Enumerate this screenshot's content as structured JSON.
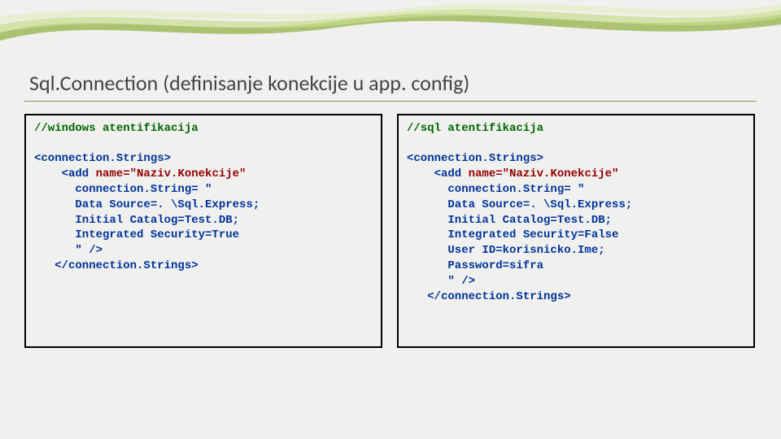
{
  "title": "Sql.Connection (definisanje konekcije u app. config)",
  "left": {
    "comment": "//windows atentifikacija",
    "l1": "<connection.Strings>",
    "l2": "    <add ",
    "name_attr": "name=\"Naziv.Konekcije\"",
    "l3": "      connection.String= \"",
    "l4": "      Data Source=. \\Sql.Express;",
    "l5": "      Initial Catalog=Test.DB;",
    "l6": "      Integrated Security=True",
    "l7": "      \" />",
    "l8": "   </connection.Strings>"
  },
  "right": {
    "comment": "//sql atentifikacija",
    "l1": "<connection.Strings>",
    "l2": "    <add ",
    "name_attr": "name=\"Naziv.Konekcije\"",
    "l3": "      connection.String= \"",
    "l4": "      Data Source=. \\Sql.Express;",
    "l5": "      Initial Catalog=Test.DB;",
    "l6": "      Integrated Security=False",
    "l7": "      User ID=korisnicko.Ime;",
    "l8": "      Password=sifra",
    "l9": "      \" />",
    "l10": "   </connection.Strings>"
  }
}
